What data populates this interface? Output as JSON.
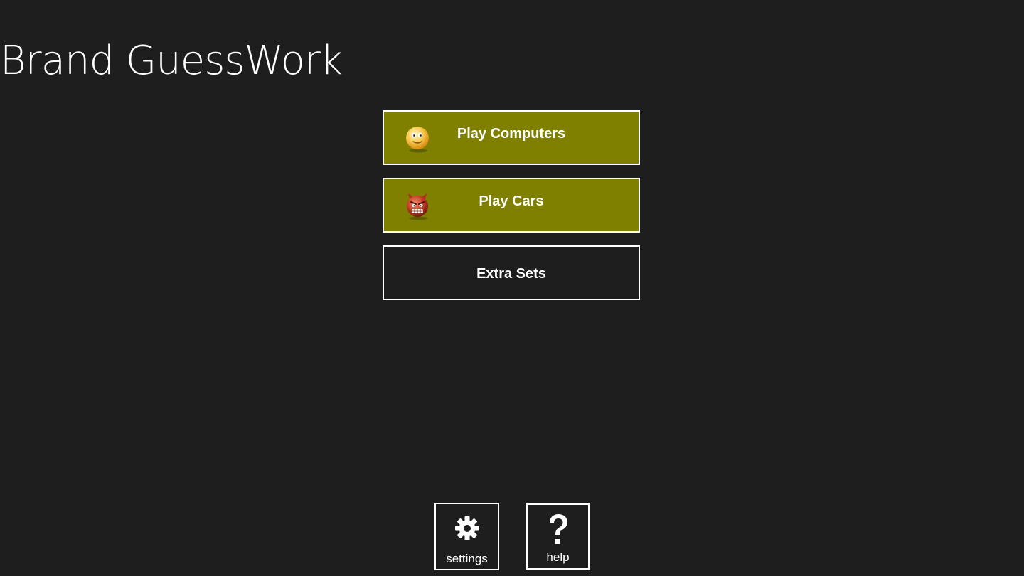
{
  "app": {
    "title": "Brand GuessWork"
  },
  "menu": {
    "play_computers": {
      "label": "Play Computers",
      "icon": "smiley-emoji-icon"
    },
    "play_cars": {
      "label": "Play Cars",
      "icon": "devil-emoji-icon"
    },
    "extra_sets": {
      "label": "Extra Sets"
    }
  },
  "toolbar": {
    "settings": {
      "label": "settings",
      "icon": "gear-icon"
    },
    "help": {
      "label": "help",
      "icon": "question-mark-icon"
    }
  },
  "colors": {
    "background": "#1e1e1e",
    "accent_olive": "#808000",
    "border": "#ffffff",
    "text": "#ffffff"
  }
}
